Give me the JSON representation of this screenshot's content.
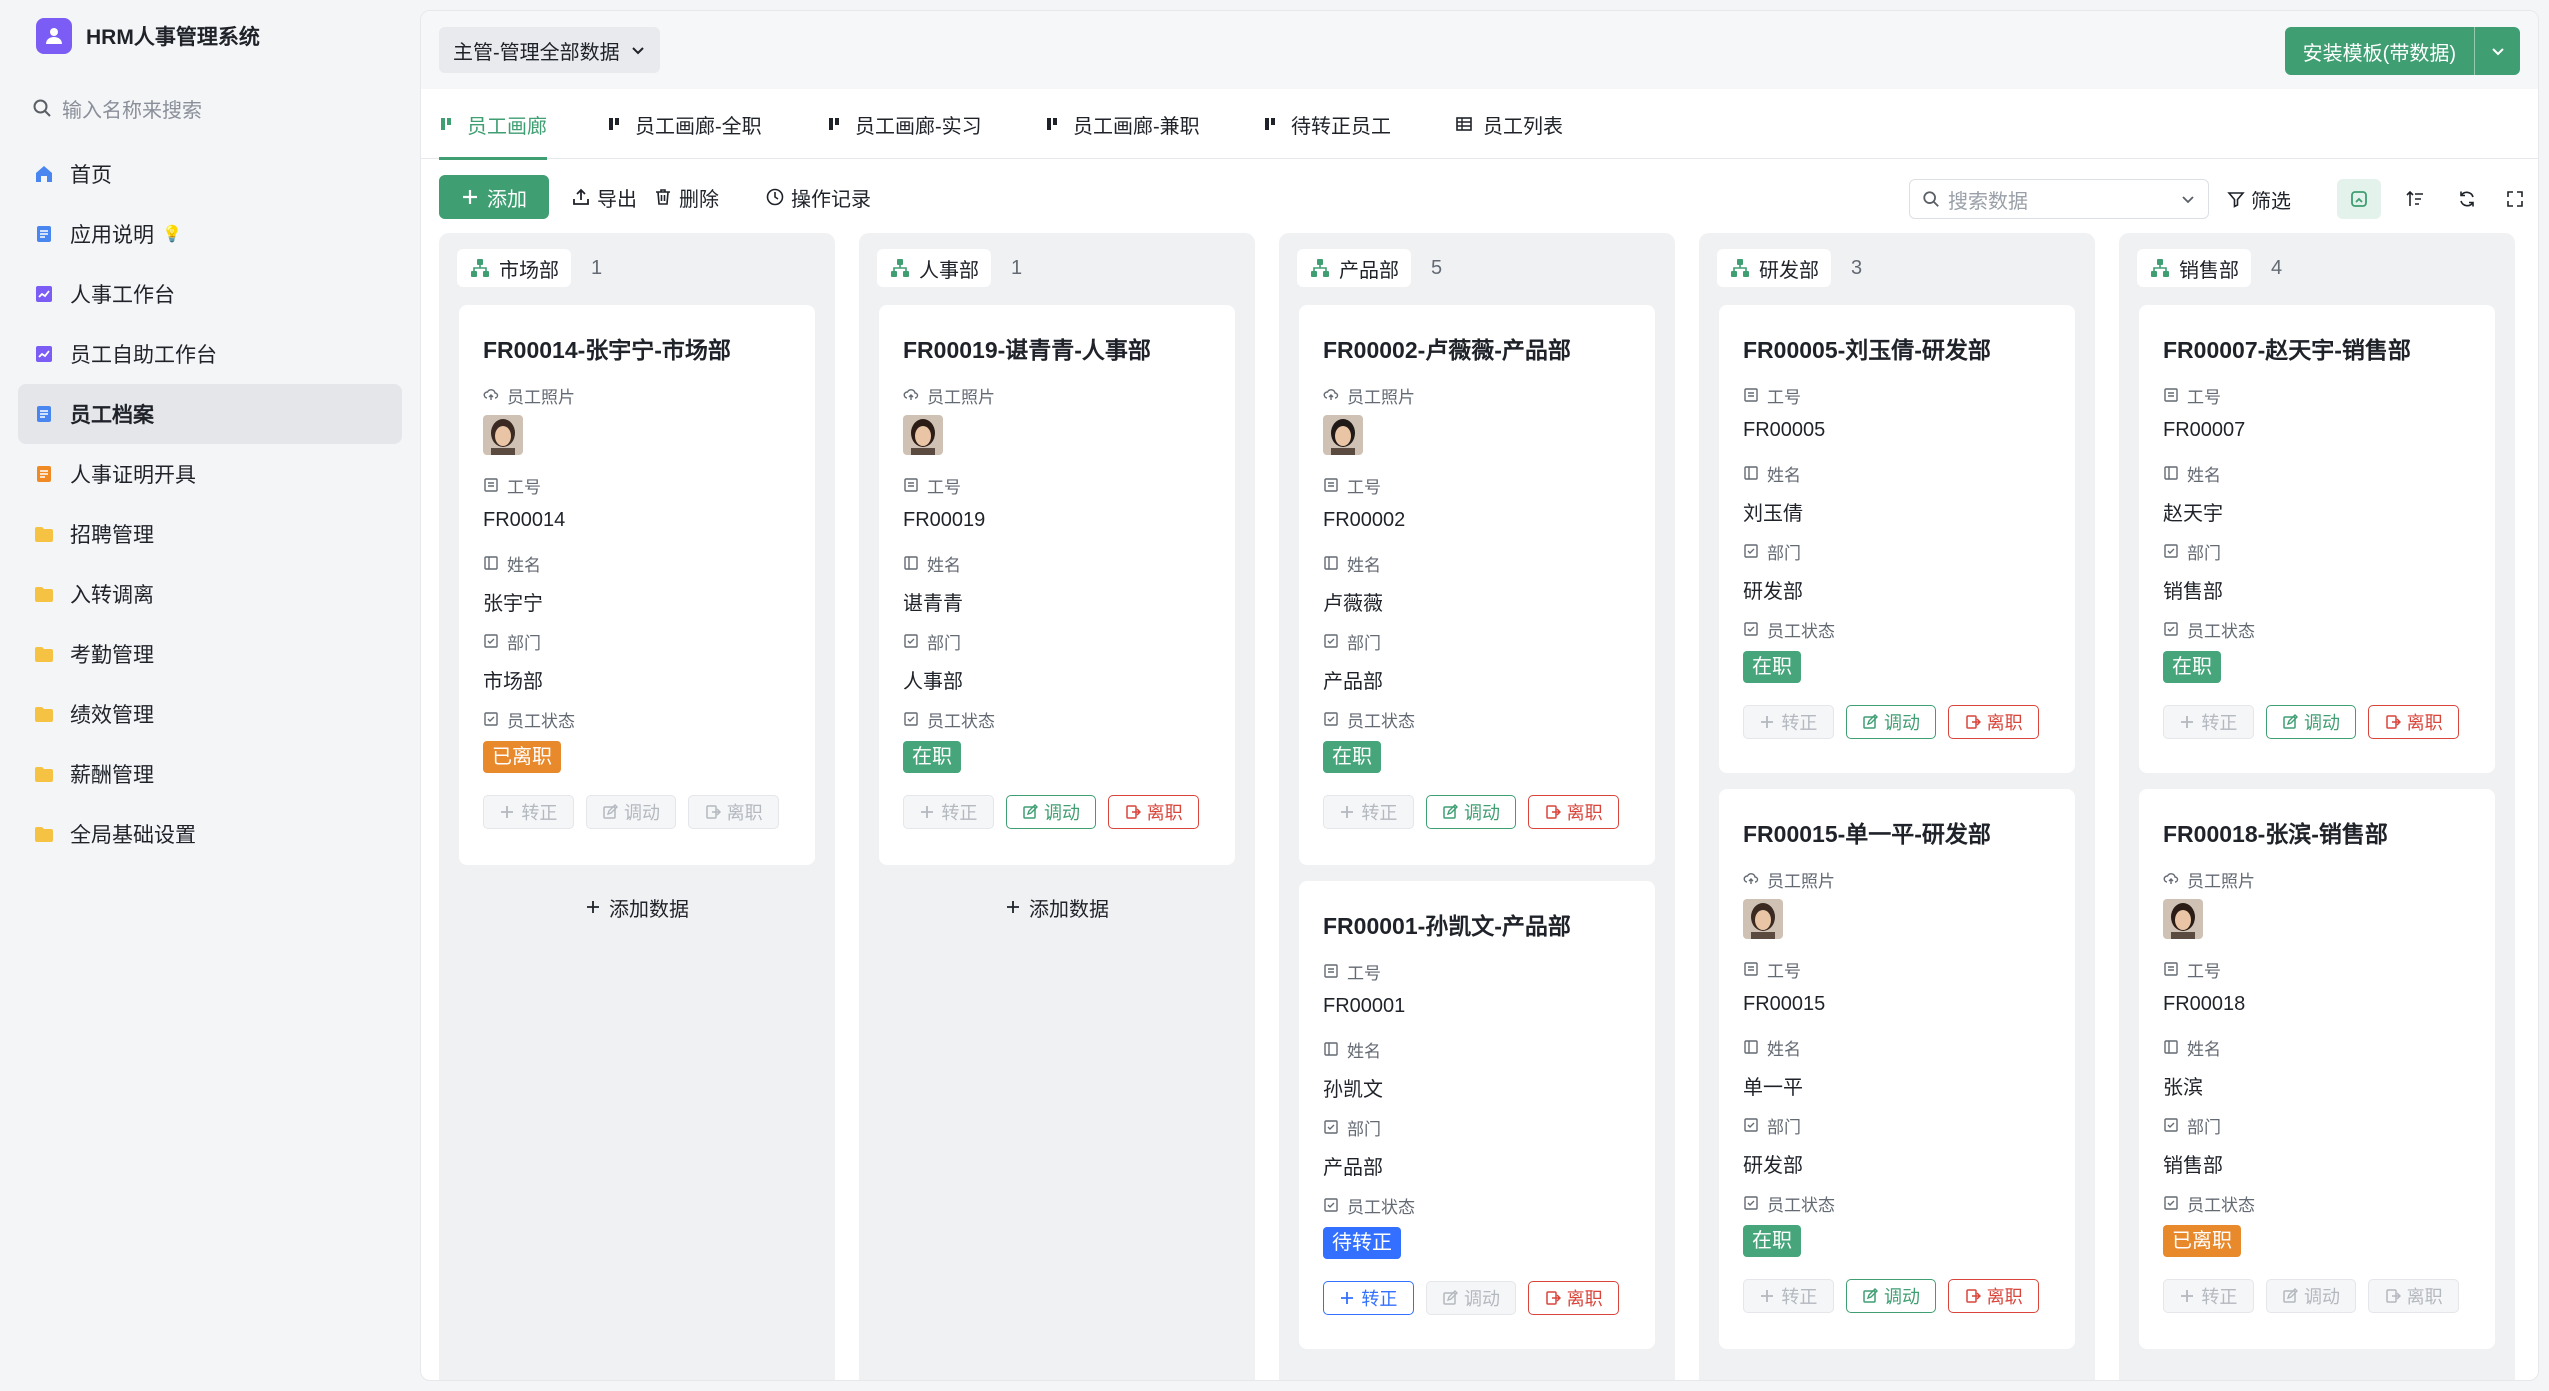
{
  "app": {
    "title": "HRM人事管理系统"
  },
  "sidebar": {
    "search_placeholder": "输入名称来搜索",
    "items": [
      {
        "label": "首页",
        "icon": "home-icon"
      },
      {
        "label": "应用说明",
        "icon": "doc-icon",
        "extra": "💡"
      },
      {
        "label": "人事工作台",
        "icon": "chart-icon"
      },
      {
        "label": "员工自助工作台",
        "icon": "chart-icon"
      },
      {
        "label": "员工档案",
        "icon": "doc-icon",
        "active": true
      },
      {
        "label": "人事证明开具",
        "icon": "doc-orange-icon"
      },
      {
        "label": "招聘管理",
        "icon": "folder-icon"
      },
      {
        "label": "入转调离",
        "icon": "folder-icon"
      },
      {
        "label": "考勤管理",
        "icon": "folder-icon"
      },
      {
        "label": "绩效管理",
        "icon": "folder-icon"
      },
      {
        "label": "薪酬管理",
        "icon": "folder-icon"
      },
      {
        "label": "全局基础设置",
        "icon": "folder-icon"
      }
    ]
  },
  "topbar": {
    "scope": "主管-管理全部数据",
    "install_button": "安装模板(带数据)"
  },
  "tabs": [
    {
      "label": "员工画廊",
      "icon": "kanban-icon",
      "active": true
    },
    {
      "label": "员工画廊-全职",
      "icon": "kanban-icon"
    },
    {
      "label": "员工画廊-实习",
      "icon": "kanban-icon"
    },
    {
      "label": "员工画廊-兼职",
      "icon": "kanban-icon"
    },
    {
      "label": "待转正员工",
      "icon": "kanban-icon"
    },
    {
      "label": "员工列表",
      "icon": "table-icon"
    }
  ],
  "toolbar": {
    "add": "添加",
    "export": "导出",
    "delete": "删除",
    "history": "操作记录",
    "search_placeholder": "搜索数据",
    "filter": "筛选"
  },
  "labels": {
    "photo": "员工照片",
    "id": "工号",
    "name": "姓名",
    "dept": "部门",
    "status": "员工状态",
    "btn_regularize": "转正",
    "btn_transfer": "调动",
    "btn_leave": "离职",
    "add_data": "添加数据"
  },
  "colors": {
    "accent": "#3f9e72",
    "status_active": "#46a57a",
    "status_left": "#e8892c",
    "status_probation": "#3370ff",
    "danger": "#d9453b"
  },
  "columns": [
    {
      "name": "市场部",
      "count": "1",
      "cards": [
        {
          "title": "FR00014-张宇宁-市场部",
          "has_photo": true,
          "id": "FR00014",
          "name": "张宇宁",
          "dept": "市场部",
          "status": "已离职",
          "status_kind": "left",
          "actions": [
            "disabled",
            "disabled",
            "disabled"
          ]
        }
      ]
    },
    {
      "name": "人事部",
      "count": "1",
      "cards": [
        {
          "title": "FR00019-谌青青-人事部",
          "has_photo": true,
          "id": "FR00019",
          "name": "谌青青",
          "dept": "人事部",
          "status": "在职",
          "status_kind": "active",
          "actions": [
            "disabled",
            "green",
            "red"
          ]
        }
      ]
    },
    {
      "name": "产品部",
      "count": "5",
      "cards": [
        {
          "title": "FR00002-卢薇薇-产品部",
          "has_photo": true,
          "id": "FR00002",
          "name": "卢薇薇",
          "dept": "产品部",
          "status": "在职",
          "status_kind": "active",
          "actions": [
            "disabled",
            "green",
            "red"
          ]
        },
        {
          "title": "FR00001-孙凯文-产品部",
          "has_photo": false,
          "id": "FR00001",
          "name": "孙凯文",
          "dept": "产品部",
          "status": "待转正",
          "status_kind": "probation",
          "actions": [
            "blue",
            "disabled",
            "red"
          ]
        }
      ]
    },
    {
      "name": "研发部",
      "count": "3",
      "cards": [
        {
          "title": "FR00005-刘玉倩-研发部",
          "has_photo": false,
          "id": "FR00005",
          "name": "刘玉倩",
          "dept": "研发部",
          "status": "在职",
          "status_kind": "active",
          "actions": [
            "disabled",
            "green",
            "red"
          ]
        },
        {
          "title": "FR00015-单一平-研发部",
          "has_photo": true,
          "id": "FR00015",
          "name": "单一平",
          "dept": "研发部",
          "status": "在职",
          "status_kind": "active",
          "actions": [
            "disabled",
            "green",
            "red"
          ]
        }
      ]
    },
    {
      "name": "销售部",
      "count": "4",
      "cards": [
        {
          "title": "FR00007-赵天宇-销售部",
          "has_photo": false,
          "id": "FR00007",
          "name": "赵天宇",
          "dept": "销售部",
          "status": "在职",
          "status_kind": "active",
          "actions": [
            "disabled",
            "green",
            "red"
          ]
        },
        {
          "title": "FR00018-张滨-销售部",
          "has_photo": true,
          "id": "FR00018",
          "name": "张滨",
          "dept": "销售部",
          "status": "已离职",
          "status_kind": "left",
          "actions": [
            "disabled",
            "disabled",
            "disabled"
          ]
        }
      ]
    }
  ]
}
